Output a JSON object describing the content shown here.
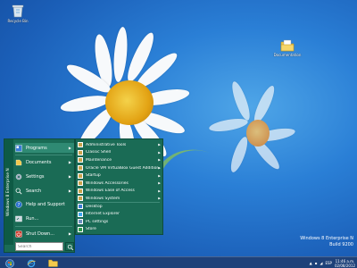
{
  "desktop": {
    "icons": [
      {
        "name": "Recycle Bin",
        "icon": "recycle-bin-icon"
      },
      {
        "name": "Documentation",
        "icon": "folder-icon"
      }
    ]
  },
  "start_menu": {
    "side_brand": "Windows 8 Enterprise N",
    "items": [
      {
        "label": "Programs",
        "icon": "programs-icon",
        "has_submenu": true
      },
      {
        "label": "Documents",
        "icon": "documents-icon",
        "has_submenu": true
      },
      {
        "label": "Settings",
        "icon": "settings-icon",
        "has_submenu": true
      },
      {
        "label": "Search",
        "icon": "search-icon",
        "has_submenu": true
      },
      {
        "label": "Help and Support",
        "icon": "help-icon",
        "has_submenu": false
      },
      {
        "label": "Run...",
        "icon": "run-icon",
        "has_submenu": false
      },
      {
        "label": "Shut Down...",
        "icon": "shutdown-icon",
        "has_submenu": true
      }
    ],
    "search_placeholder": "Search",
    "submenu": [
      {
        "label": "Administrative Tools",
        "has_submenu": true
      },
      {
        "label": "Classic Shell",
        "has_submenu": true
      },
      {
        "label": "Maintenance",
        "has_submenu": true
      },
      {
        "label": "Oracle VM VirtualBox Guest Additions",
        "has_submenu": true
      },
      {
        "label": "Startup",
        "has_submenu": true
      },
      {
        "label": "Windows Accessories",
        "has_submenu": true
      },
      {
        "label": "Windows Ease of Access",
        "has_submenu": true
      },
      {
        "label": "Windows System",
        "has_submenu": true
      },
      {
        "label": "Desktop",
        "has_submenu": false
      },
      {
        "label": "Internet Explorer",
        "has_submenu": false
      },
      {
        "label": "PC settings",
        "has_submenu": false
      },
      {
        "label": "Store",
        "has_submenu": false
      }
    ]
  },
  "watermark": {
    "line1": "Windows 8 Enterprise N",
    "line2": "Build 9200"
  },
  "taskbar": {
    "buttons": [
      "start-orb-icon",
      "internet-explorer-icon",
      "file-explorer-icon"
    ],
    "tray_lang": "ESP",
    "time": "11:46 a.m.",
    "date": "02/08/2012"
  },
  "colors": {
    "menu_bg": "#1a6b55",
    "menu_active": "#2f8a73",
    "wallpaper": "#2a7fd6"
  }
}
